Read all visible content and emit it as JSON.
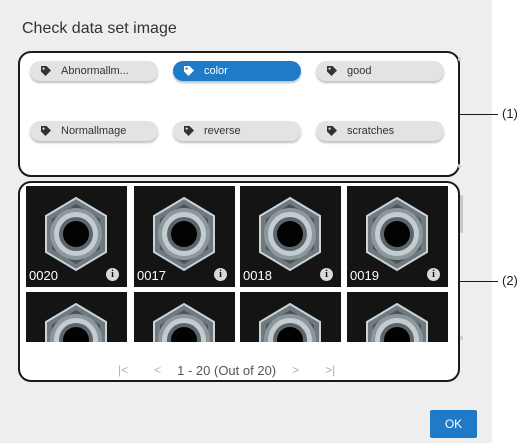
{
  "dialog": {
    "title": "Check data set image",
    "ok_label": "OK"
  },
  "tags": [
    {
      "label": "Abnormallm...",
      "selected": false
    },
    {
      "label": "color",
      "selected": true
    },
    {
      "label": "good",
      "selected": false
    },
    {
      "label": "Normallmage",
      "selected": false
    },
    {
      "label": "reverse",
      "selected": false
    },
    {
      "label": "scratches",
      "selected": false
    }
  ],
  "images": [
    {
      "number": "0020"
    },
    {
      "number": "0017"
    },
    {
      "number": "0018"
    },
    {
      "number": "0019"
    },
    {
      "number": ""
    },
    {
      "number": ""
    },
    {
      "number": ""
    },
    {
      "number": ""
    }
  ],
  "pager": {
    "first": "|<",
    "prev": "<",
    "range": "1 - 20 (Out of 20)",
    "next": ">",
    "last": ">|"
  },
  "callouts": {
    "tags": "(1)",
    "images": "(2)"
  },
  "colors": {
    "accent": "#1f7ac8",
    "dialog_bg": "#eeeeee",
    "tag_bg": "#e3e3e3"
  },
  "icons": {
    "tag": "tag-icon",
    "info": "info-icon"
  }
}
